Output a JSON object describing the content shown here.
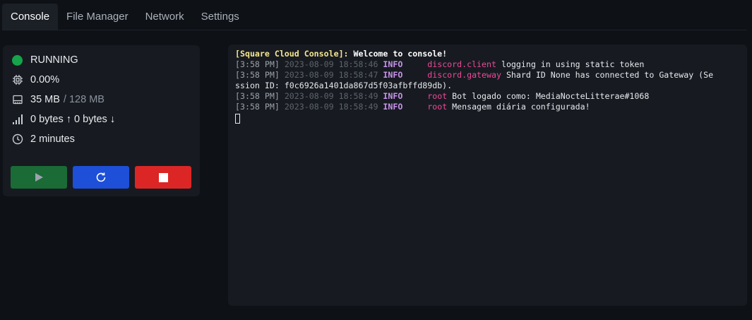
{
  "tabs": [
    {
      "label": "Console",
      "active": true
    },
    {
      "label": "File Manager",
      "active": false
    },
    {
      "label": "Network",
      "active": false
    },
    {
      "label": "Settings",
      "active": false
    }
  ],
  "status": {
    "state": "RUNNING",
    "state_color": "#16a34a",
    "cpu": "0.00%",
    "memory_used": "35 MB",
    "memory_total": "/ 128 MB",
    "network": "0 bytes ↑ 0 bytes ↓",
    "uptime": "2 minutes"
  },
  "controls": {
    "start_icon": "play-icon",
    "restart_icon": "restart-icon",
    "stop_icon": "stop-icon",
    "colors": {
      "start": "#1a6b35",
      "restart": "#1d4fd8",
      "stop": "#dc2626"
    }
  },
  "console": {
    "welcome_prefix": "[Square Cloud Console]:",
    "welcome_text": " Welcome to console!",
    "logs": [
      {
        "time": "[3:58 PM]",
        "date": "2023-08-09 18:58:46",
        "level": "INFO",
        "source": "discord.client",
        "message": "logging in using static token"
      },
      {
        "time": "[3:58 PM]",
        "date": "2023-08-09 18:58:47",
        "level": "INFO",
        "source": "discord.gateway",
        "message": "Shard ID None has connected to Gateway (Se"
      },
      {
        "time": "",
        "date": "",
        "level": "",
        "source": "",
        "message": "ssion ID: f0c6926a1401da867d5f03afbffd89db)."
      },
      {
        "time": "[3:58 PM]",
        "date": "2023-08-09 18:58:49",
        "level": "INFO",
        "source": "root",
        "message": "Bot logado como: MediaNocteLitterae#1068"
      },
      {
        "time": "[3:58 PM]",
        "date": "2023-08-09 18:58:49",
        "level": "INFO",
        "source": "root",
        "message": "Mensagem diária configurada!"
      }
    ]
  }
}
